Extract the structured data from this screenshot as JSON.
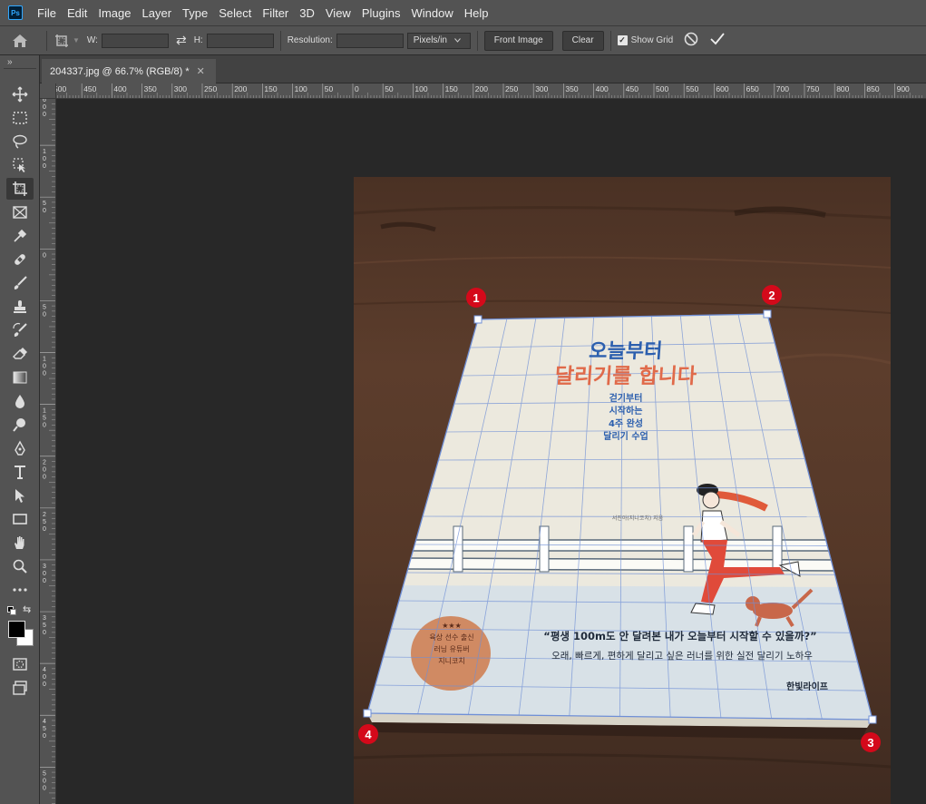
{
  "menubar": {
    "logo": "Ps",
    "items": [
      "File",
      "Edit",
      "Image",
      "Layer",
      "Type",
      "Select",
      "Filter",
      "3D",
      "View",
      "Plugins",
      "Window",
      "Help"
    ]
  },
  "options": {
    "w_label": "W:",
    "h_label": "H:",
    "resolution_label": "Resolution:",
    "units": "Pixels/in",
    "front_image": "Front Image",
    "clear": "Clear",
    "show_grid": "Show Grid"
  },
  "tab": {
    "title": "204337.jpg @ 66.7% (RGB/8) *"
  },
  "ruler": {
    "top_labels": [
      "500",
      "450",
      "400",
      "350",
      "300",
      "250",
      "200",
      "150",
      "100",
      "50",
      "0",
      "50",
      "100",
      "150",
      "200",
      "250",
      "300",
      "350",
      "400",
      "450",
      "500",
      "550",
      "600",
      "650",
      "700",
      "750",
      "800",
      "850",
      "900"
    ],
    "left_labels": [
      "6\n0\n0",
      "1\n0\n0",
      "5\n0",
      "0",
      "5\n0",
      "1\n0\n0",
      "1\n5\n0",
      "2\n0\n0",
      "2\n5\n0",
      "3\n0\n0",
      "3\n5\n0",
      "4\n0\n0",
      "4\n5\n0",
      "5\n0\n0",
      "5\n5\n0"
    ]
  },
  "book": {
    "title_line1": "오늘부터",
    "title_line2": "달리기를 합니다",
    "subtitle_lines": [
      "걷기부터",
      "시작하는",
      "4주 완성",
      "달리기 수업"
    ],
    "author": "서진아(지니코치) 지음",
    "badge_lines": [
      "★★★",
      "육상 선수 출신",
      "러닝 유튜버",
      "지니코치"
    ],
    "quote": "“평생 100m도 안 달려본 내가 오늘부터 시작할 수 있을까?”",
    "tagline": "오래, 빠르게, 편하게 달리고 싶은 러너를 위한 실전 달리기 노하우",
    "publisher": "한빛라이프"
  },
  "markers": [
    "1",
    "2",
    "3",
    "4"
  ],
  "colors": {
    "accent_red": "#d4091a",
    "grid_blue": "#6f8fd6",
    "ps_blue": "#31a8ff"
  }
}
